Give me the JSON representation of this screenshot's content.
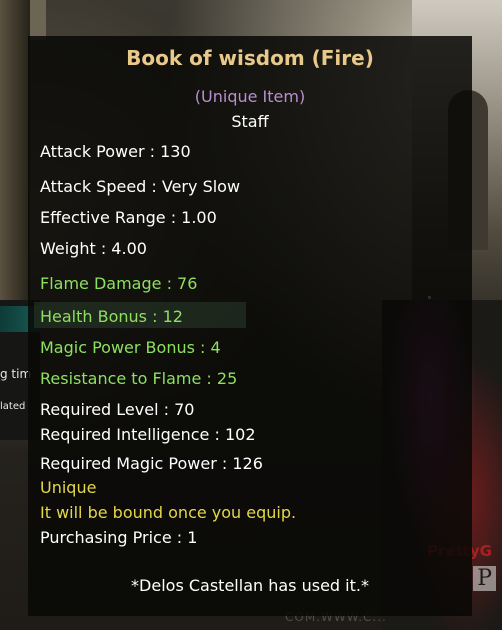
{
  "tooltip": {
    "title": "Book of wisdom (Fire)",
    "rarity": "(Unique Item)",
    "item_type": "Staff",
    "stats": {
      "attack_power": "Attack Power : 130",
      "attack_speed": "Attack Speed : Very Slow",
      "effective_range": "Effective Range : 1.00",
      "weight": "Weight : 4.00"
    },
    "bonuses": {
      "flame_damage": "Flame Damage : 76",
      "health_bonus": "Health Bonus : 12",
      "magic_power_bonus": "Magic Power Bonus : 4",
      "resistance_to_flame": "Resistance to Flame : 25"
    },
    "requirements": {
      "level": "Required Level : 70",
      "intelligence": "Required Intelligence : 102",
      "magic_power": "Required Magic Power : 126"
    },
    "unique_label": "Unique",
    "bound_notice": "It will be bound once you equip.",
    "purchasing_price": "Purchasing Price : 1",
    "footer": "*Delos Castellan has used it.*"
  },
  "background_fragments": {
    "left_text_1": "g tim",
    "left_text_2": "lated"
  },
  "watermark": {
    "line_1": "PrettyG",
    "line_2": "P",
    "line_3": "COM.WWW.C..."
  },
  "colors": {
    "title": "#e8c98a",
    "rarity": "#b98fcf",
    "bonus_green": "#8ee060",
    "notice_yellow": "#e3d84a",
    "text_white": "#ffffff",
    "panel_bg": "#080806"
  }
}
